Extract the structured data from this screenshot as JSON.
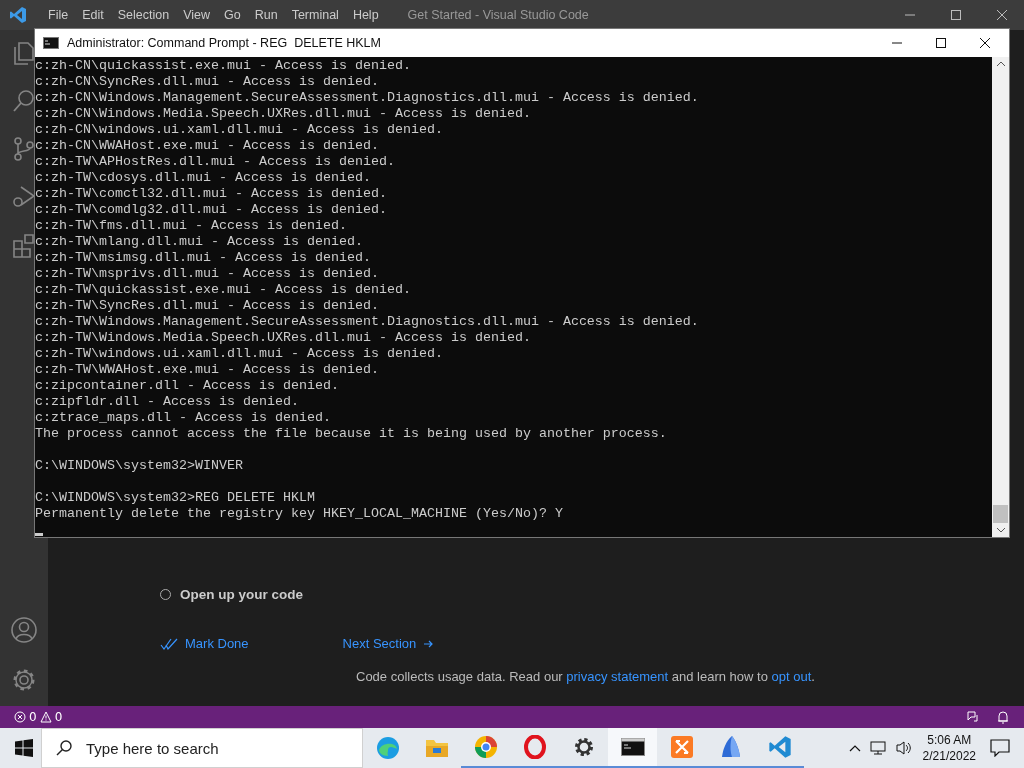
{
  "vscode": {
    "title": "Get Started - Visual Studio Code",
    "menu": [
      "File",
      "Edit",
      "Selection",
      "View",
      "Go",
      "Run",
      "Terminal",
      "Help"
    ],
    "steps": [
      {
        "label": "Open up your code",
        "checked": false
      }
    ],
    "mark_done": "Mark Done",
    "next_section": "Next Section",
    "footer": {
      "before": "Code collects usage data. Read our ",
      "link1": "privacy statement",
      "middle": " and learn how to ",
      "link2": "opt out",
      "after": "."
    },
    "status_bar": {
      "errors": "0",
      "warnings": "0"
    }
  },
  "console": {
    "title": "Administrator: Command Prompt - REG  DELETE HKLM",
    "blocks": [
      [
        "c:zh-CN\\quickassist.exe.mui - Access is denied.",
        "c:zh-CN\\SyncRes.dll.mui - Access is denied.",
        "c:zh-CN\\Windows.Management.SecureAssessment.Diagnostics.dll.mui - Access is denied.",
        "c:zh-CN\\Windows.Media.Speech.UXRes.dll.mui - Access is denied.",
        "c:zh-CN\\windows.ui.xaml.dll.mui - Access is denied.",
        "c:zh-CN\\WWAHost.exe.mui - Access is denied.",
        "c:zh-TW\\APHostRes.dll.mui - Access is denied.",
        "c:zh-TW\\cdosys.dll.mui - Access is denied.",
        "c:zh-TW\\comctl32.dll.mui - Access is denied.",
        "c:zh-TW\\comdlg32.dll.mui - Access is denied.",
        "c:zh-TW\\fms.dll.mui - Access is denied.",
        "c:zh-TW\\mlang.dll.mui - Access is denied.",
        "c:zh-TW\\msimsg.dll.mui - Access is denied.",
        "c:zh-TW\\msprivs.dll.mui - Access is denied.",
        "c:zh-TW\\quickassist.exe.mui - Access is denied.",
        "c:zh-TW\\SyncRes.dll.mui - Access is denied.",
        "c:zh-TW\\Windows.Management.SecureAssessment.Diagnostics.dll.mui - Access is denied.",
        "c:zh-TW\\Windows.Media.Speech.UXRes.dll.mui - Access is denied.",
        "c:zh-TW\\windows.ui.xaml.dll.mui - Access is denied.",
        "c:zh-TW\\WWAHost.exe.mui - Access is denied.",
        "c:zipcontainer.dll - Access is denied.",
        "c:zipfldr.dll - Access is denied.",
        "c:ztrace_maps.dll - Access is denied.",
        "The process cannot access the file because it is being used by another process."
      ],
      [
        "C:\\WINDOWS\\system32>WINVER"
      ],
      [
        "C:\\WINDOWS\\system32>REG DELETE HKLM",
        "Permanently delete the registry key HKEY_LOCAL_MACHINE (Yes/No)? Y"
      ]
    ]
  },
  "taskbar": {
    "search": {
      "placeholder": "Type here to search"
    },
    "apps": [
      {
        "kind": "edge",
        "running": false,
        "selected": false
      },
      {
        "kind": "folder",
        "running": false,
        "selected": false
      },
      {
        "kind": "ring",
        "running": true,
        "selected": false
      },
      {
        "kind": "opera",
        "running": true,
        "selected": false
      },
      {
        "kind": "gear",
        "running": true,
        "selected": false
      },
      {
        "kind": "terminal",
        "running": true,
        "selected": true
      },
      {
        "kind": "xampp",
        "running": true,
        "selected": false
      },
      {
        "kind": "sail",
        "running": true,
        "selected": false
      },
      {
        "kind": "vscode",
        "running": true,
        "selected": false
      }
    ],
    "time": "5:06 AM",
    "date": "2/21/2022"
  }
}
